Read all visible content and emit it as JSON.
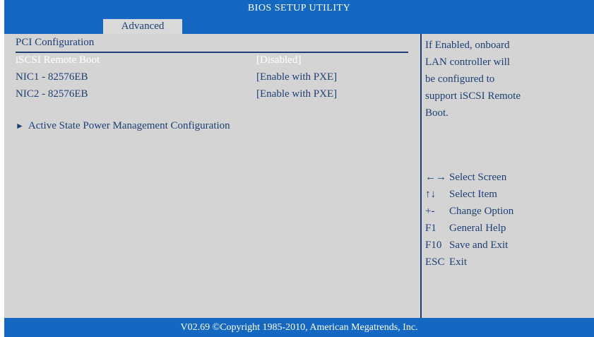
{
  "header": {
    "title": "BIOS SETUP UTILITY",
    "tab": "Advanced"
  },
  "section": {
    "title": "PCI Configuration"
  },
  "items": [
    {
      "label": "iSCSI Remote Boot",
      "value": "[Disabled]"
    },
    {
      "label": "NIC1 - 82576EB",
      "value": "[Enable with PXE]"
    },
    {
      "label": "NIC2 - 82576EB",
      "value": "[Enable with PXE]"
    }
  ],
  "submenu": {
    "arrow": "►",
    "label": "Active State Power Management Configuration"
  },
  "help": {
    "lines": [
      "If Enabled, onboard",
      "LAN controller will",
      "be configured to",
      "support iSCSI Remote",
      "Boot."
    ]
  },
  "keys": [
    {
      "key": "←→",
      "desc": "Select Screen"
    },
    {
      "key": "↑↓",
      "desc": "Select Item"
    },
    {
      "key": "+-",
      "desc": "Change Option"
    },
    {
      "key": "F1",
      "desc": "General Help"
    },
    {
      "key": "F10",
      "desc": "Save and Exit"
    },
    {
      "key": "ESC",
      "desc": "Exit"
    }
  ],
  "footer": {
    "text": "V02.69 ©Copyright 1985-2010, American Megatrends, Inc."
  },
  "colors": {
    "bar": "#1468c1",
    "text": "#1c3f75",
    "panel": "#d4d4d4",
    "selected": "#ffffff"
  }
}
